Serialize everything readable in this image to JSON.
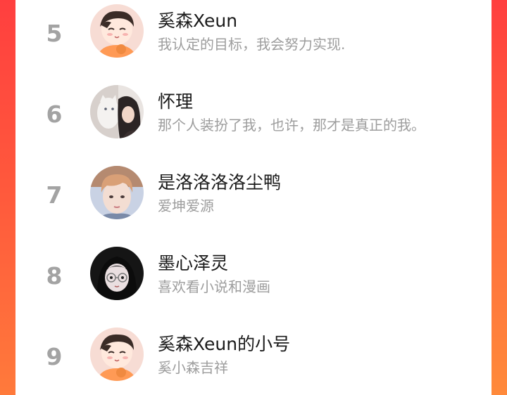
{
  "users": [
    {
      "rank": "5",
      "name": "奚森Xeun",
      "bio": "我认定的目标，我会努力实现.",
      "avatar": "cartoon-boy-avatar"
    },
    {
      "rank": "6",
      "name": "怀理",
      "bio": "那个人装扮了我，也许，那才是真正的我。",
      "avatar": "girl-with-cat-avatar"
    },
    {
      "rank": "7",
      "name": "是洛洛洛洛尘鸭",
      "bio": "爱坤爱源",
      "avatar": "boy-portrait-avatar"
    },
    {
      "rank": "8",
      "name": "墨心泽灵",
      "bio": "喜欢看小说和漫画",
      "avatar": "anime-girl-glasses-avatar"
    },
    {
      "rank": "9",
      "name": "奚森Xeun的小号",
      "bio": "奚小森吉祥",
      "avatar": "cartoon-boy-avatar"
    }
  ],
  "colors": {
    "background_gradient_top": "#ff4a3a",
    "background_gradient_bottom": "#ff8a3a",
    "rank_color": "#a3a3a3",
    "name_color": "#1a1a1a",
    "bio_color": "#9d9d9d"
  }
}
